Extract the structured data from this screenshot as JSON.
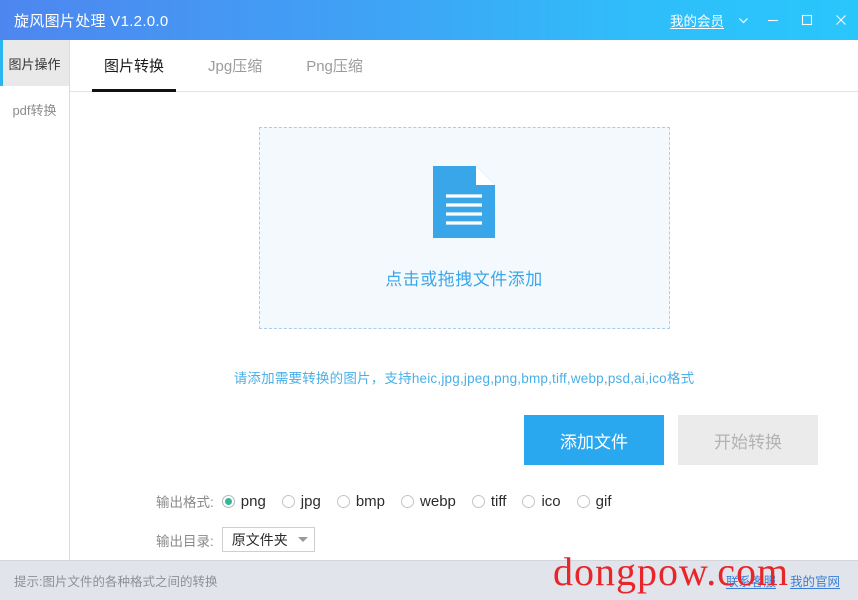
{
  "window": {
    "title": "旋风图片处理 V1.2.0.0",
    "member_link": "我的会员",
    "chevron_icon": "chevron-down-icon",
    "minimize_icon": "minimize-icon",
    "maximize_icon": "maximize-icon",
    "close_icon": "close-icon",
    "gradient_start": "#4e86f0",
    "gradient_end": "#29c6fc"
  },
  "sidebar": {
    "items": [
      {
        "label": "图片操作",
        "active": true
      },
      {
        "label": "pdf转换",
        "active": false
      }
    ],
    "accent_color": "#29b6f0"
  },
  "tabs": [
    {
      "label": "图片转换",
      "active": true
    },
    {
      "label": "Jpg压缩",
      "active": false
    },
    {
      "label": "Png压缩",
      "active": false
    }
  ],
  "dropzone": {
    "icon": "document-file-icon",
    "label": "点击或拖拽文件添加",
    "text_color": "#3ba7e8",
    "border_color": "#a9cdf0",
    "fill_color": "#f4f9fe"
  },
  "hint": {
    "text": "请添加需要转换的图片，支持heic,jpg,jpeg,png,bmp,tiff,webp,psd,ai,ico格式",
    "color": "#49b0e8"
  },
  "buttons": {
    "add_file": "添加文件",
    "start_convert": "开始转换",
    "primary_color": "#29a8f0",
    "disabled_color": "#ebebeb"
  },
  "output_format": {
    "label": "输出格式:",
    "selected": "png",
    "selected_color": "#2fb89a",
    "options": [
      "png",
      "jpg",
      "bmp",
      "webp",
      "tiff",
      "ico",
      "gif"
    ]
  },
  "output_dir": {
    "label": "输出目录:",
    "value": "原文件夹",
    "caret_icon": "chevron-down-icon"
  },
  "statusbar": {
    "text": "提示:图片文件的各种格式之间的转换",
    "links": [
      {
        "label": "联系客服"
      },
      {
        "label": "我的官网"
      }
    ]
  },
  "watermark": {
    "text": "dongpow.com",
    "color": "#e8262a"
  }
}
